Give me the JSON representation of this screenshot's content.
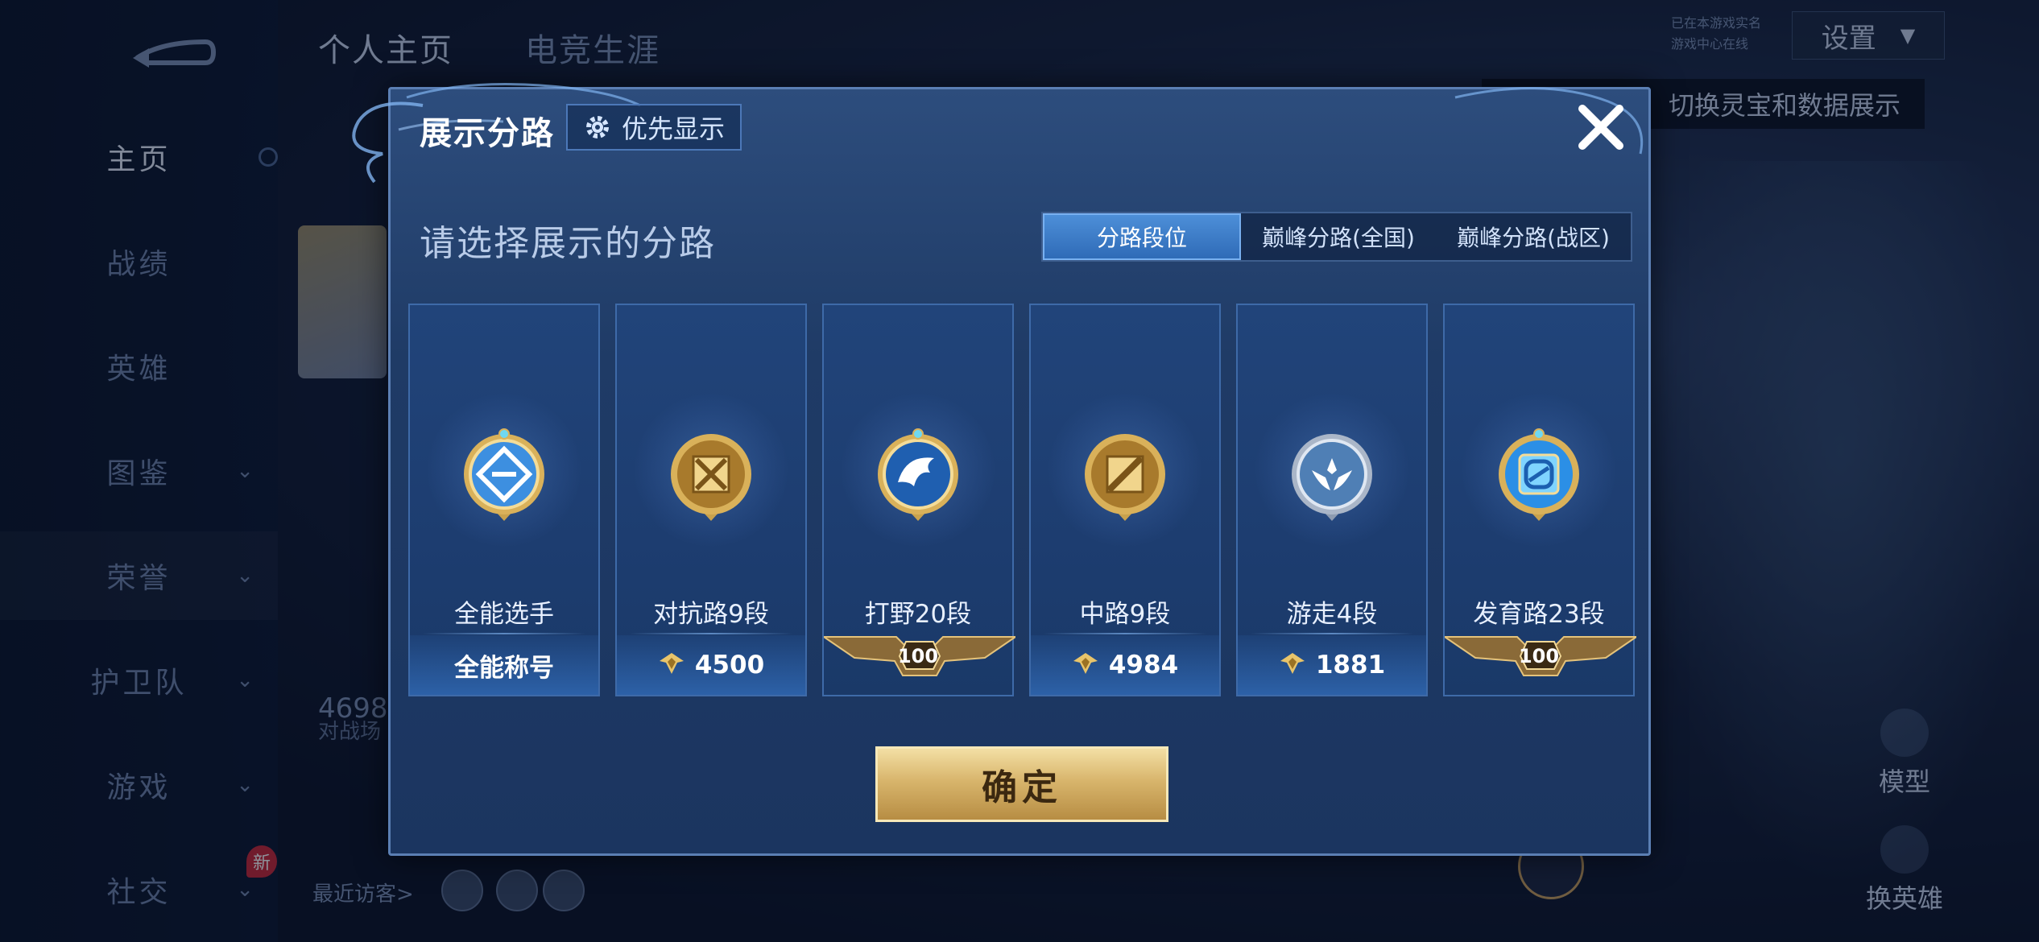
{
  "background": {
    "top_tabs": [
      "个人主页",
      "电竞生涯"
    ],
    "sidebar": [
      {
        "label": "主页"
      },
      {
        "label": "战绩"
      },
      {
        "label": "英雄"
      },
      {
        "label": "图鉴"
      },
      {
        "label": "荣誉"
      },
      {
        "label": "护卫队"
      },
      {
        "label": "游戏"
      },
      {
        "label": "社交"
      }
    ],
    "new_badge": "新",
    "profile_number": "4698",
    "profile_sub": "对战场",
    "visitors_label": "最近访客>",
    "settings_label": "设置",
    "hint_text": "切换灵宝和数据展示",
    "side_actions": [
      "模型",
      "换英雄"
    ],
    "small_tags": [
      "已在本游戏实名",
      "游戏中心在线"
    ]
  },
  "modal": {
    "title": "展示分路",
    "priority_button": "优先显示",
    "subtitle": "请选择展示的分路",
    "tabs": [
      {
        "label": "分路段位",
        "active": true
      },
      {
        "label": "巅峰分路(全国)",
        "active": false
      },
      {
        "label": "巅峰分路(战区)",
        "active": false
      }
    ],
    "cards": [
      {
        "name": "全能选手",
        "footer": "全能称号",
        "badge": "all-round-badge-icon",
        "footer_type": "text"
      },
      {
        "name": "对抗路9段",
        "footer": "4500",
        "badge": "clash-lane-badge-icon",
        "footer_type": "points"
      },
      {
        "name": "打野20段",
        "footer": "100",
        "badge": "jungle-badge-icon",
        "footer_type": "wings"
      },
      {
        "name": "中路9段",
        "footer": "4984",
        "badge": "mid-lane-badge-icon",
        "footer_type": "points"
      },
      {
        "name": "游走4段",
        "footer": "1881",
        "badge": "roam-badge-icon",
        "footer_type": "points"
      },
      {
        "name": "发育路23段",
        "footer": "100",
        "badge": "farm-lane-badge-icon",
        "footer_type": "wings"
      }
    ],
    "confirm_button": "确定"
  },
  "colors": {
    "modal_bg": "#1f3b66",
    "active_tab": "#2f6bb7",
    "confirm_gold": "#d8b56c",
    "card_border": "#3e6aa8"
  }
}
